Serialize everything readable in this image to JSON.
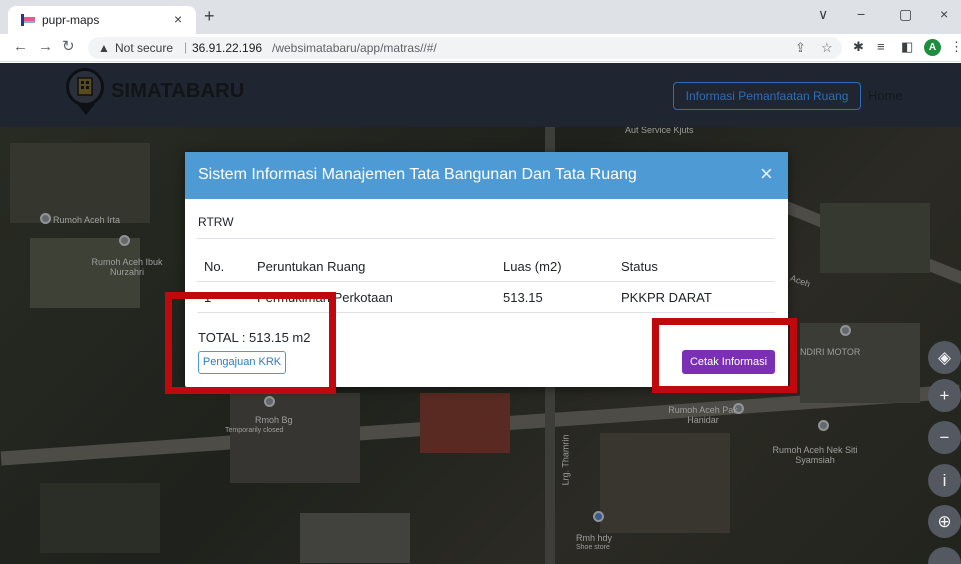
{
  "browser": {
    "tab_title": "pupr-maps",
    "tab_close": "×",
    "new_tab": "+",
    "window_controls": [
      "∨",
      "−",
      "▢",
      "×"
    ],
    "not_secure": "Not secure",
    "url_host": "36.91.22.196",
    "url_path": "/websimatabaru/app/matras//#/",
    "profile_initial": "A"
  },
  "navbar": {
    "brand": "SIMATABARU",
    "info_button": "Informasi Pemanfaatan Ruang",
    "home": "Home"
  },
  "map": {
    "labels": [
      {
        "text": "Rumoh Aceh Irta"
      },
      {
        "text": "Rumoh Aceh Ibuk Nurzahri"
      },
      {
        "text": "Rmoh Bg"
      },
      {
        "text": "Temporarily closed"
      },
      {
        "text": "Lrg. Thamrin"
      },
      {
        "text": "Rumoh Aceh Pak Hanidar"
      },
      {
        "text": "Rumoh Aceh Nek Siti Syamsiah"
      },
      {
        "text": "Rmh hdy"
      },
      {
        "text": "Shoe store"
      },
      {
        "text": "NDIRI MOTOR"
      },
      {
        "text": "Aceh"
      },
      {
        "text": "Aut Service Kjuts"
      }
    ],
    "controls": [
      {
        "name": "layers-icon",
        "glyph": "◈"
      },
      {
        "name": "zoom-in-icon",
        "glyph": "+"
      },
      {
        "name": "zoom-out-icon",
        "glyph": "−"
      },
      {
        "name": "info-icon",
        "glyph": "i"
      },
      {
        "name": "globe-icon",
        "glyph": "⊕"
      }
    ]
  },
  "modal": {
    "title": "Sistem Informasi Manajemen Tata Bangunan Dan Tata Ruang",
    "close": "×",
    "section": "RTRW",
    "table": {
      "headers": [
        "No.",
        "Peruntukan Ruang",
        "Luas (m2)",
        "Status"
      ],
      "rows": [
        [
          "1",
          "Permukiman Perkotaan",
          "513.15",
          "PKKPR DARAT"
        ]
      ]
    },
    "total": "TOTAL : 513.15 m2",
    "krk_button": "Pengajuan KRK",
    "print_button": "Cetak Informasi"
  },
  "colors": {
    "modal_header": "#4d9ad5",
    "print_button": "#7b2fb5",
    "highlight": "#c0090d"
  }
}
